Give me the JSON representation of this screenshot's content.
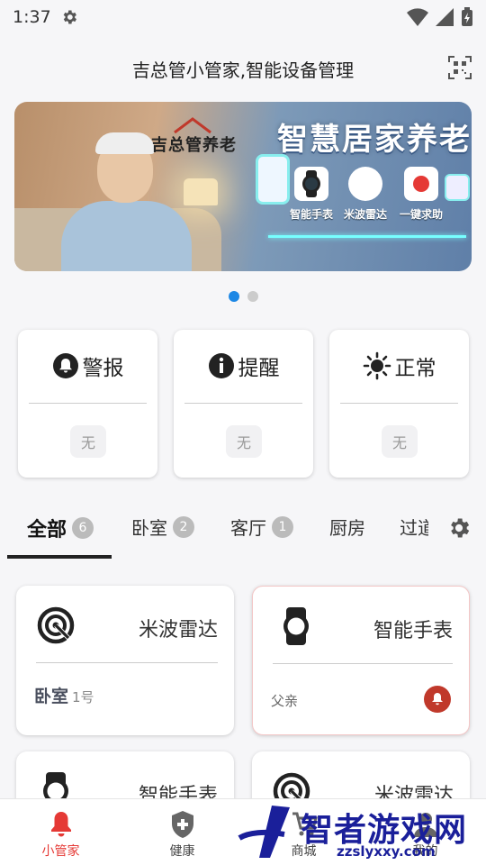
{
  "status_bar": {
    "time": "1:37"
  },
  "header": {
    "title": "吉总管小管家,智能设备管理"
  },
  "banner": {
    "brand": "吉总管养老",
    "headline": "智慧居家养老",
    "devices": [
      "智能手表",
      "米波雷达",
      "一键求助"
    ]
  },
  "status_cards": [
    {
      "label": "警报",
      "value": "无",
      "icon": "bell-icon"
    },
    {
      "label": "提醒",
      "value": "无",
      "icon": "info-icon"
    },
    {
      "label": "正常",
      "value": "无",
      "icon": "sun-icon"
    }
  ],
  "tabs": [
    {
      "label": "全部",
      "count": "6"
    },
    {
      "label": "卧室",
      "count": "2"
    },
    {
      "label": "客厅",
      "count": "1"
    },
    {
      "label": "厨房"
    },
    {
      "label": "过道"
    }
  ],
  "devices": [
    {
      "name": "米波雷达",
      "location": "卧室",
      "location_sub": "1号",
      "icon": "radar-icon"
    },
    {
      "name": "智能手表",
      "owner": "父亲",
      "icon": "watch-icon",
      "status": "alert"
    },
    {
      "name": "智能手表",
      "icon": "watch-icon"
    },
    {
      "name": "米波雷达",
      "icon": "radar-icon"
    }
  ],
  "bottom_nav": [
    {
      "label": "小管家",
      "icon": "bell-icon",
      "active": true
    },
    {
      "label": "健康",
      "icon": "shield-plus-icon"
    },
    {
      "label": "商城",
      "icon": "cart-icon"
    },
    {
      "label": "我的",
      "icon": "user-icon"
    }
  ],
  "watermark": {
    "text": "智者游戏网",
    "url": "zzslyxxy.com"
  },
  "colors": {
    "accent": "#1e88e5",
    "alert": "#c0392b",
    "nav_active": "#e53935"
  }
}
